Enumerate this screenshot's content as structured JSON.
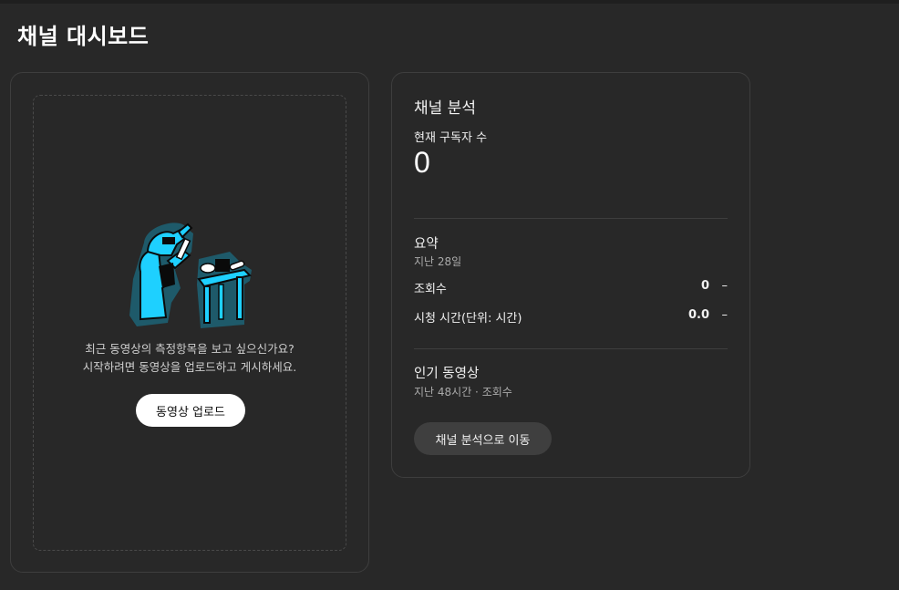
{
  "header": {
    "title": "채널 대시보드"
  },
  "upload_card": {
    "illustration": "scientist-microscope-illustration",
    "message_line1": "최근 동영상의 측정항목을 보고 싶으신가요?",
    "message_line2": "시작하려면 동영상을 업로드하고 게시하세요.",
    "upload_label": "동영상 업로드"
  },
  "analytics_card": {
    "title": "채널 분석",
    "subscribers_label": "현재 구독자 수",
    "subscribers_value": "0",
    "summary": {
      "title": "요약",
      "period": "지난 28일",
      "metrics": [
        {
          "label": "조회수",
          "value": "0",
          "trend": "–"
        },
        {
          "label": "시청 시간(단위: 시간)",
          "value": "0.0",
          "trend": "–"
        }
      ]
    },
    "popular": {
      "title": "인기 동영상",
      "period": "지난 48시간 · 조회수"
    },
    "goto_label": "채널 분석으로 이동"
  },
  "colors": {
    "background": "#282828",
    "card_border": "#3e3e3e",
    "illustration_accent": "#1ed0ff",
    "illustration_dark": "#1e5a6a"
  }
}
